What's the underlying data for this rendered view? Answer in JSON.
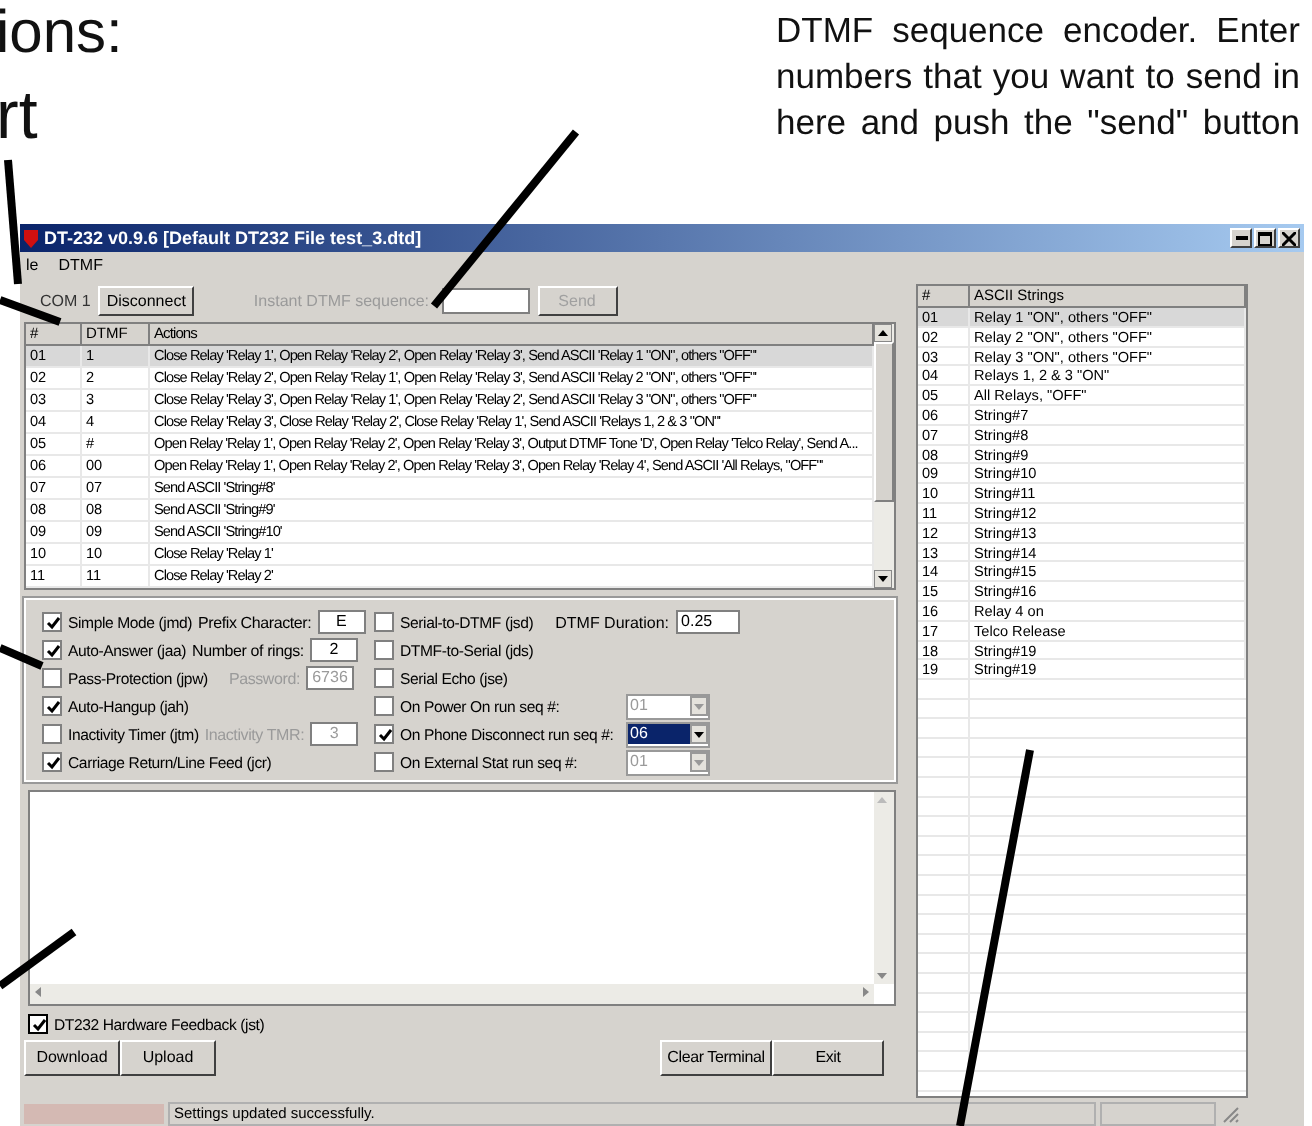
{
  "annotations": {
    "left_heading": "ions:",
    "left_label": "rt",
    "callout_lines": [
      "DTMF sequence encoder.  Enter",
      "numbers that you want to send in",
      "here and push the \"send\" button"
    ]
  },
  "window": {
    "title": "DT-232 v0.9.6 [Default DT232 File test_3.dtd]"
  },
  "menu": [
    "le",
    "DTMF"
  ],
  "toolbar": {
    "port": "COM 1",
    "connect_button": "Disconnect",
    "dtmf_label": "Instant DTMF sequence:",
    "send_button": {
      "label": "Send",
      "disabled": true
    }
  },
  "actions_table": {
    "columns": [
      "#",
      "DTMF",
      "Actions"
    ],
    "rows": [
      {
        "num": "01",
        "dtmf": "1",
        "action": "Close Relay 'Relay 1', Open Relay 'Relay 2', Open Relay 'Relay 3', Send ASCII 'Relay 1 \"ON\", others \"OFF\"'",
        "selected": true
      },
      {
        "num": "02",
        "dtmf": "2",
        "action": "Close Relay 'Relay 2', Open Relay 'Relay 1', Open Relay 'Relay 3', Send ASCII 'Relay 2 \"ON\", others \"OFF\"'",
        "selected": false
      },
      {
        "num": "03",
        "dtmf": "3",
        "action": "Close Relay 'Relay 3', Open Relay 'Relay 1', Open Relay 'Relay 2', Send ASCII 'Relay 3 \"ON\", others \"OFF\"'",
        "selected": false
      },
      {
        "num": "04",
        "dtmf": "4",
        "action": "Close Relay 'Relay 3', Close Relay 'Relay 2', Close Relay 'Relay 1', Send ASCII 'Relays 1, 2 & 3 \"ON\"'",
        "selected": false
      },
      {
        "num": "05",
        "dtmf": "#",
        "action": "Open Relay 'Relay 1', Open Relay 'Relay 2', Open Relay 'Relay 3', Output DTMF Tone 'D', Open Relay 'Telco Relay', Send A...",
        "selected": false
      },
      {
        "num": "06",
        "dtmf": "00",
        "action": "Open Relay 'Relay 1', Open Relay 'Relay 2', Open Relay 'Relay 3', Open Relay 'Relay 4', Send ASCII 'All Relays, \"OFF\"'",
        "selected": false
      },
      {
        "num": "07",
        "dtmf": "07",
        "action": "Send ASCII 'String#8'",
        "selected": false
      },
      {
        "num": "08",
        "dtmf": "08",
        "action": "Send ASCII 'String#9'",
        "selected": false
      },
      {
        "num": "09",
        "dtmf": "09",
        "action": "Send ASCII 'String#10'",
        "selected": false
      },
      {
        "num": "10",
        "dtmf": "10",
        "action": "Close Relay 'Relay 1'",
        "selected": false
      },
      {
        "num": "11",
        "dtmf": "11",
        "action": "Close Relay 'Relay 2'",
        "selected": false
      }
    ]
  },
  "options_left": [
    {
      "label": "Simple Mode (jmd)",
      "checked": true,
      "field": {
        "label": "Prefix Character:",
        "value": "E",
        "disabled": false
      }
    },
    {
      "label": "Auto-Answer (jaa)",
      "checked": true,
      "field": {
        "label": "Number of rings:",
        "value": "2",
        "disabled": false
      }
    },
    {
      "label": "Pass-Protection (jpw)",
      "checked": false,
      "field": {
        "label": "Password:",
        "value": "6736",
        "disabled": true
      }
    },
    {
      "label": "Auto-Hangup (jah)",
      "checked": true
    },
    {
      "label": "Inactivity Timer (jtm)",
      "checked": false,
      "field": {
        "label": "Inactivity TMR:",
        "value": "3",
        "disabled": true
      }
    },
    {
      "label": "Carriage Return/Line Feed (jcr)",
      "checked": true
    }
  ],
  "options_right": [
    {
      "kind": "field",
      "label": "Serial-to-DTMF (jsd)",
      "checked": false,
      "field": {
        "label": "DTMF Duration:",
        "value": "0.25",
        "disabled": false
      }
    },
    {
      "kind": "plain",
      "label": "DTMF-to-Serial (jds)",
      "checked": false
    },
    {
      "kind": "plain",
      "label": "Serial Echo (jse)",
      "checked": false
    },
    {
      "kind": "combo",
      "label": "On Power On run seq #:",
      "checked": false,
      "combo": {
        "value": "01",
        "disabled": true,
        "selected": false
      }
    },
    {
      "kind": "combo",
      "label": "On Phone Disconnect run seq #:",
      "checked": true,
      "combo": {
        "value": "06",
        "disabled": false,
        "selected": true
      }
    },
    {
      "kind": "combo",
      "label": "On External Stat run seq #:",
      "checked": false,
      "combo": {
        "value": "01",
        "disabled": true,
        "selected": false
      }
    }
  ],
  "hardware_feedback": {
    "label": "DT232 Hardware Feedback (jst)",
    "checked": true
  },
  "buttons_left": [
    "Download",
    "Upload"
  ],
  "buttons_right": [
    "Clear Terminal",
    "Exit"
  ],
  "status_bar": {
    "message": "Settings updated successfully."
  },
  "ascii_table": {
    "columns": [
      "#",
      "ASCII Strings"
    ],
    "rows": [
      {
        "num": "01",
        "text": "Relay 1 \"ON\", others \"OFF\"",
        "selected": true
      },
      {
        "num": "02",
        "text": "Relay 2 \"ON\", others \"OFF\"",
        "selected": false
      },
      {
        "num": "03",
        "text": "Relay 3 \"ON\", others \"OFF\"",
        "selected": false
      },
      {
        "num": "04",
        "text": "Relays 1, 2 & 3 \"ON\"",
        "selected": false
      },
      {
        "num": "05",
        "text": "All Relays, \"OFF\"",
        "selected": false
      },
      {
        "num": "06",
        "text": "String#7",
        "selected": false
      },
      {
        "num": "07",
        "text": "String#8",
        "selected": false
      },
      {
        "num": "08",
        "text": "String#9",
        "selected": false
      },
      {
        "num": "09",
        "text": "String#10",
        "selected": false
      },
      {
        "num": "10",
        "text": "String#11",
        "selected": false
      },
      {
        "num": "11",
        "text": "String#12",
        "selected": false
      },
      {
        "num": "12",
        "text": "String#13",
        "selected": false
      },
      {
        "num": "13",
        "text": "String#14",
        "selected": false
      },
      {
        "num": "14",
        "text": "String#15",
        "selected": false
      },
      {
        "num": "15",
        "text": "String#16",
        "selected": false
      },
      {
        "num": "16",
        "text": "Relay 4 on",
        "selected": false
      },
      {
        "num": "17",
        "text": "Telco Release",
        "selected": false
      },
      {
        "num": "18",
        "text": "String#19",
        "selected": false
      },
      {
        "num": "19",
        "text": "String#19",
        "selected": false
      }
    ]
  }
}
